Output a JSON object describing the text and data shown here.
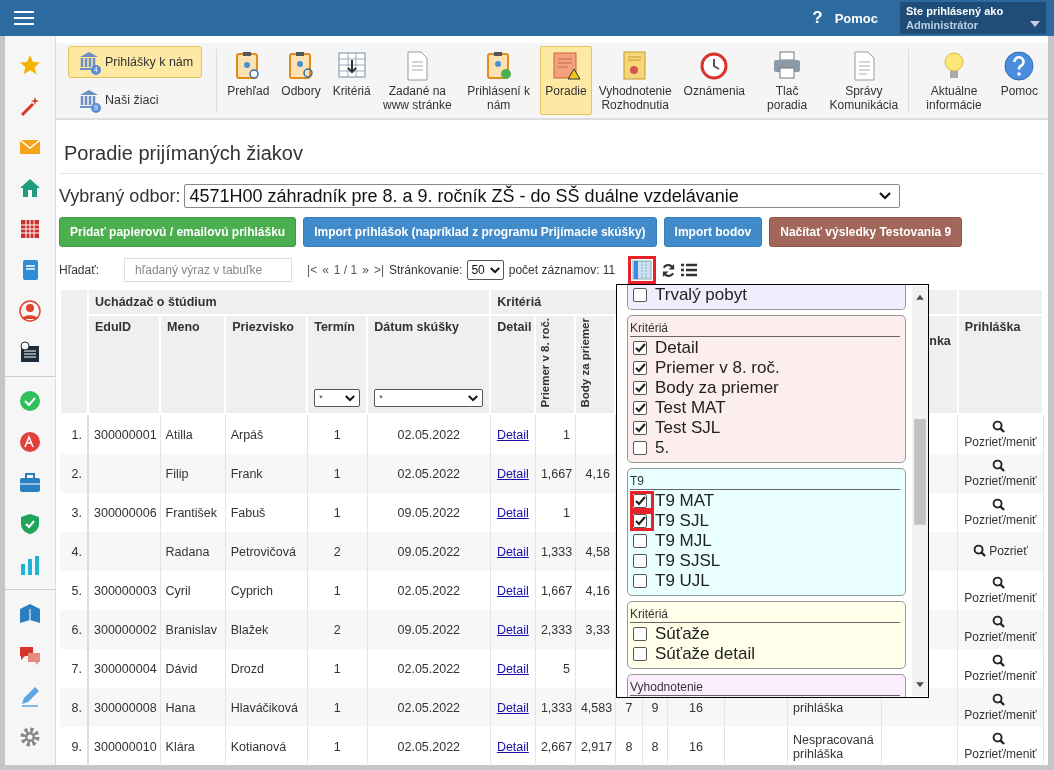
{
  "top_bar": {
    "help_icon": "?",
    "help": "Pomoc",
    "user": {
      "label": "Ste prihlásený ako",
      "name": "Administrátor"
    }
  },
  "toolbar": {
    "modules": [
      {
        "label": "Prihlášky k nám",
        "badge": "4",
        "selected": true
      },
      {
        "label": "Naši žiaci",
        "badge": "9",
        "selected": false
      }
    ],
    "items": [
      {
        "label": "Prehľad",
        "selected": false
      },
      {
        "label": "Odbory",
        "selected": false
      },
      {
        "label": "Kritériá",
        "selected": false
      },
      {
        "label": "Zadané na www stránke",
        "selected": false
      },
      {
        "label": "Prihlásení k nám",
        "selected": false
      },
      {
        "label": "Poradie",
        "selected": true
      },
      {
        "label": "Vyhodnotenie Rozhodnutia",
        "selected": false
      },
      {
        "label": "Oznámenia",
        "selected": false
      },
      {
        "label": "Tlač poradia",
        "selected": false
      },
      {
        "label": "Správy Komunikácia",
        "selected": false
      },
      {
        "label": "Aktuálne informácie",
        "selected": false
      },
      {
        "label": "Pomoc",
        "selected": false
      }
    ]
  },
  "page": {
    "title": "Poradie prijímaných žiakov",
    "odbor": {
      "label": "Vybraný odbor:",
      "value": "4571H00 záhradník pre 8. a 9. ročník ZŠ - do SŠ duálne vzdelávanie"
    },
    "buttons": [
      {
        "label": "Pridať papierovú / emailovú prihlášku",
        "kind": "success"
      },
      {
        "label": "Import prihlášok (napríklad z programu Prijímacie skúšky)",
        "kind": "primary"
      },
      {
        "label": "Import bodov",
        "kind": "primary"
      },
      {
        "label": "Načítať výsledky Testovania 9",
        "kind": "danger"
      }
    ],
    "search": {
      "label": "Hľadať:",
      "placeholder": "hľadaný výraz v tabuľke"
    },
    "pager": {
      "first": "|<",
      "prev": "«",
      "page": "1 / 1",
      "next": "»",
      "last": ">|"
    },
    "page_size": {
      "label": "Stránkovanie:",
      "value": "50"
    },
    "record_count": "počet záznamov: 11",
    "column_chooser": {
      "highlighted": true
    }
  },
  "table": {
    "groups": [
      {
        "label": "Uchádzač o štúdium",
        "columns": [
          {
            "label": "EduID",
            "kind": "text"
          },
          {
            "label": "Meno",
            "kind": "text"
          },
          {
            "label": "Priezvisko",
            "kind": "text"
          },
          {
            "label": "Termín",
            "kind": "center",
            "filter": "*"
          },
          {
            "label": "Dátum skúšky",
            "kind": "center",
            "filter": "*"
          }
        ]
      },
      {
        "label": "Kritériá",
        "columns": [
          {
            "label": "Detail",
            "kind": "link"
          },
          {
            "label": "Priemer v 8. roč.",
            "kind": "vertical"
          },
          {
            "label": "Body za priemer",
            "kind": "vertical"
          },
          {
            "kind": "center"
          },
          {
            "kind": "center"
          },
          {
            "kind": "center"
          },
          {
            "kind": "text"
          },
          {
            "kind": "status"
          },
          {
            "label": "nka",
            "kind": "tail"
          }
        ]
      },
      {
        "columns": [
          {
            "label": "Prihláška",
            "kind": "action"
          }
        ]
      }
    ],
    "rows": [
      {
        "number": "1.",
        "cells": [
          "300000001",
          "Atilla",
          "Arpáš",
          "1",
          "02.05.2022",
          "Detail",
          "1",
          null,
          null,
          null,
          null,
          null,
          null,
          null,
          "Pozrieť/meniť"
        ]
      },
      {
        "number": "2.",
        "cells": [
          null,
          "Filip",
          "Frank",
          "1",
          "02.05.2022",
          "Detail",
          "1,667",
          "4,16",
          null,
          null,
          null,
          null,
          null,
          null,
          "Pozrieť/meniť"
        ]
      },
      {
        "number": "3.",
        "cells": [
          "300000006",
          "František",
          "Fabuš",
          "1",
          "09.05.2022",
          "Detail",
          "1",
          null,
          null,
          null,
          null,
          null,
          null,
          null,
          "Pozrieť/meniť"
        ]
      },
      {
        "number": "4.",
        "cells": [
          null,
          "Radana",
          "Petrovičová",
          "2",
          "09.05.2022",
          "Detail",
          "1,333",
          "4,58",
          null,
          null,
          null,
          null,
          null,
          null,
          "Pozrieť"
        ]
      },
      {
        "number": "5.",
        "cells": [
          "300000003",
          "Cyril",
          "Cyprich",
          "1",
          "02.05.2022",
          "Detail",
          "1,667",
          "4,16",
          null,
          null,
          null,
          null,
          null,
          null,
          "Pozrieť/meniť"
        ]
      },
      {
        "number": "6.",
        "cells": [
          "300000002",
          "Branislav",
          "Blažek",
          "2",
          "09.05.2022",
          "Detail",
          "2,333",
          "3,33",
          null,
          null,
          null,
          null,
          null,
          null,
          "Pozrieť/meniť"
        ]
      },
      {
        "number": "7.",
        "cells": [
          "300000004",
          "Dávid",
          "Drozd",
          "1",
          "02.05.2022",
          "Detail",
          "5",
          null,
          null,
          null,
          null,
          null,
          null,
          null,
          "Pozrieť/meniť"
        ]
      },
      {
        "number": "8.",
        "cells": [
          "300000008",
          "Hana",
          "Hlaváčiková",
          "1",
          "02.05.2022",
          "Detail",
          "1,333",
          "4,583",
          "7",
          "9",
          "16",
          null,
          "prihláška",
          null,
          "Pozrieť/meniť"
        ]
      },
      {
        "number": "9.",
        "cells": [
          "300000010",
          "Klára",
          "Kotianová",
          "1",
          "02.05.2022",
          "Detail",
          "2,667",
          "2,917",
          "8",
          "8",
          "16",
          null,
          "Nespracovaná prihláška",
          null,
          "Pozrieť/meniť"
        ]
      }
    ]
  },
  "column_popup": {
    "groups": [
      {
        "color": "#eeeefc",
        "items": [
          {
            "label": "Trvalý pobyt",
            "checked": false,
            "highlighted": false
          }
        ]
      },
      {
        "title": "Kritériá",
        "color": "#fdeeee",
        "items": [
          {
            "label": "Detail",
            "checked": true,
            "highlighted": false
          },
          {
            "label": "Priemer v 8. roč.",
            "checked": true,
            "highlighted": false
          },
          {
            "label": "Body za priemer",
            "checked": true,
            "highlighted": false
          },
          {
            "label": "Test MAT",
            "checked": true,
            "highlighted": false
          },
          {
            "label": "Test SJL",
            "checked": true,
            "highlighted": false
          },
          {
            "label": "5.",
            "checked": false,
            "highlighted": false
          }
        ]
      },
      {
        "title": "T9",
        "color": "#eaffff",
        "items": [
          {
            "label": "T9 MAT",
            "checked": true,
            "highlighted": true
          },
          {
            "label": "T9 SJL",
            "checked": true,
            "highlighted": true
          },
          {
            "label": "T9 MJL",
            "checked": false,
            "highlighted": false
          },
          {
            "label": "T9 SJSL",
            "checked": false,
            "highlighted": false
          },
          {
            "label": "T9 UJL",
            "checked": false,
            "highlighted": false
          }
        ]
      },
      {
        "title": "Kritériá",
        "color": "#ffffea",
        "items": [
          {
            "label": "Súťaže",
            "checked": false,
            "highlighted": false
          },
          {
            "label": "Súťaže detail",
            "checked": false,
            "highlighted": false
          }
        ]
      },
      {
        "title": "Vyhodnotenie",
        "color": "#fdeeff"
      }
    ]
  }
}
